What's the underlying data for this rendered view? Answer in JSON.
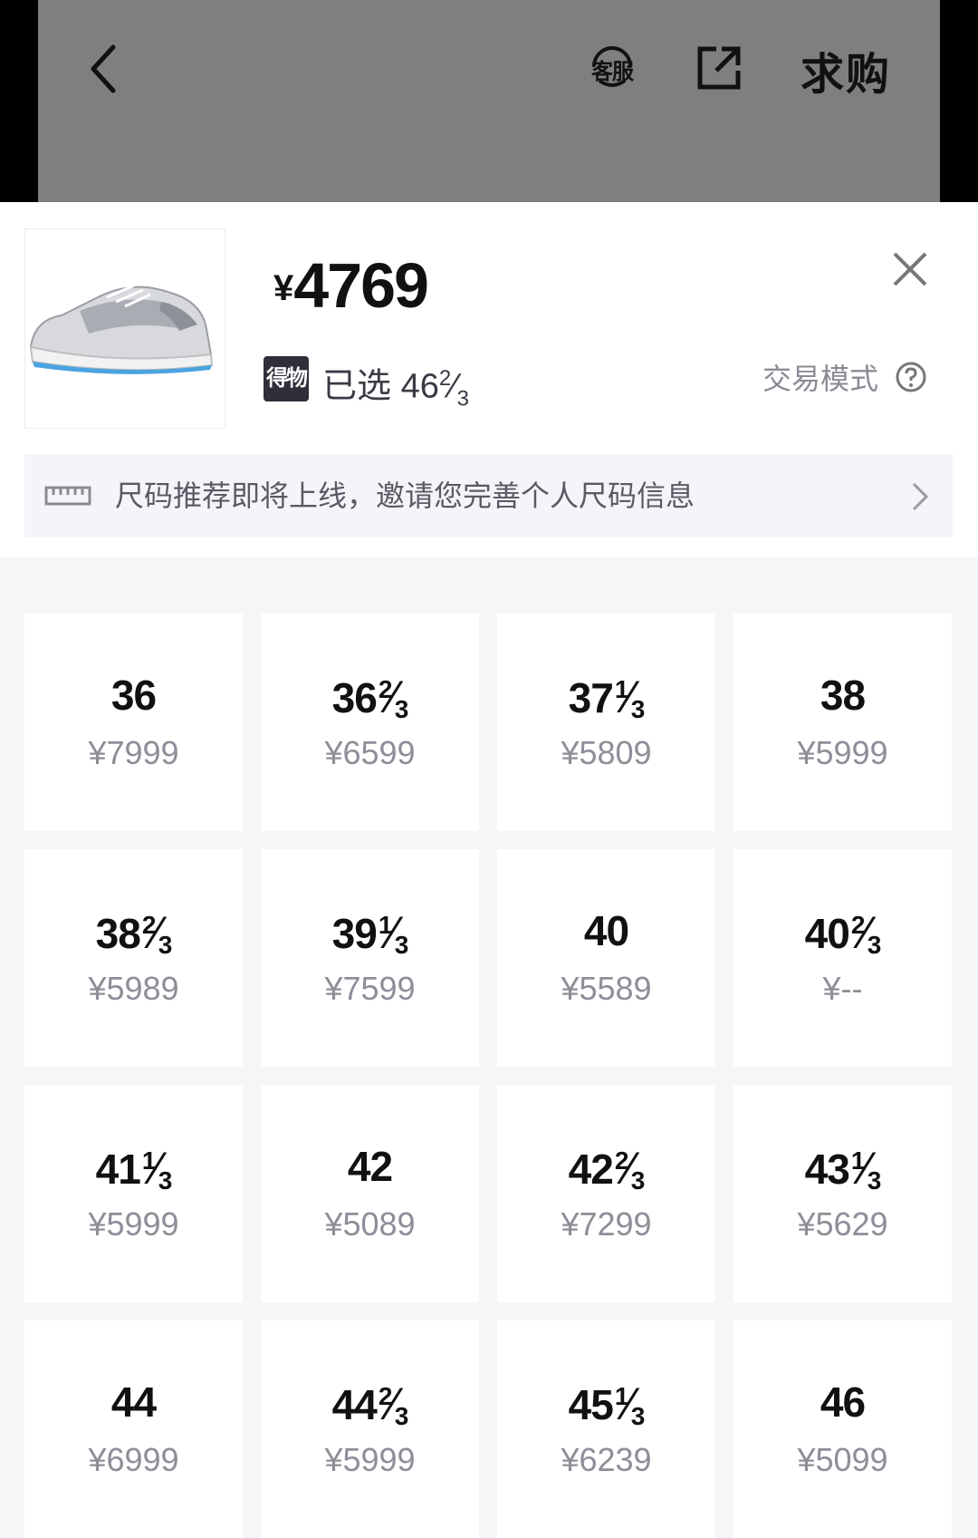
{
  "topbar": {
    "service_label": "客服",
    "buy_request_label": "求购"
  },
  "product": {
    "price_symbol": "¥",
    "price": "4769",
    "badge_label": "得物",
    "selected_prefix": "已选 ",
    "selected_size": {
      "whole": "46",
      "num": "2",
      "den": "3"
    },
    "trade_mode_label": "交易模式"
  },
  "banner": {
    "text": "尺码推荐即将上线，邀请您完善个人尺码信息"
  },
  "sizes": [
    {
      "whole": "36",
      "num": "",
      "den": "",
      "price": "¥7999"
    },
    {
      "whole": "36",
      "num": "2",
      "den": "3",
      "price": "¥6599"
    },
    {
      "whole": "37",
      "num": "1",
      "den": "3",
      "price": "¥5809"
    },
    {
      "whole": "38",
      "num": "",
      "den": "",
      "price": "¥5999"
    },
    {
      "whole": "38",
      "num": "2",
      "den": "3",
      "price": "¥5989"
    },
    {
      "whole": "39",
      "num": "1",
      "den": "3",
      "price": "¥7599"
    },
    {
      "whole": "40",
      "num": "",
      "den": "",
      "price": "¥5589"
    },
    {
      "whole": "40",
      "num": "2",
      "den": "3",
      "price": "¥--"
    },
    {
      "whole": "41",
      "num": "1",
      "den": "3",
      "price": "¥5999"
    },
    {
      "whole": "42",
      "num": "",
      "den": "",
      "price": "¥5089"
    },
    {
      "whole": "42",
      "num": "2",
      "den": "3",
      "price": "¥7299"
    },
    {
      "whole": "43",
      "num": "1",
      "den": "3",
      "price": "¥5629"
    },
    {
      "whole": "44",
      "num": "",
      "den": "",
      "price": "¥6999"
    },
    {
      "whole": "44",
      "num": "2",
      "den": "3",
      "price": "¥5999"
    },
    {
      "whole": "45",
      "num": "1",
      "den": "3",
      "price": "¥6239"
    },
    {
      "whole": "46",
      "num": "",
      "den": "",
      "price": "¥5099"
    }
  ]
}
